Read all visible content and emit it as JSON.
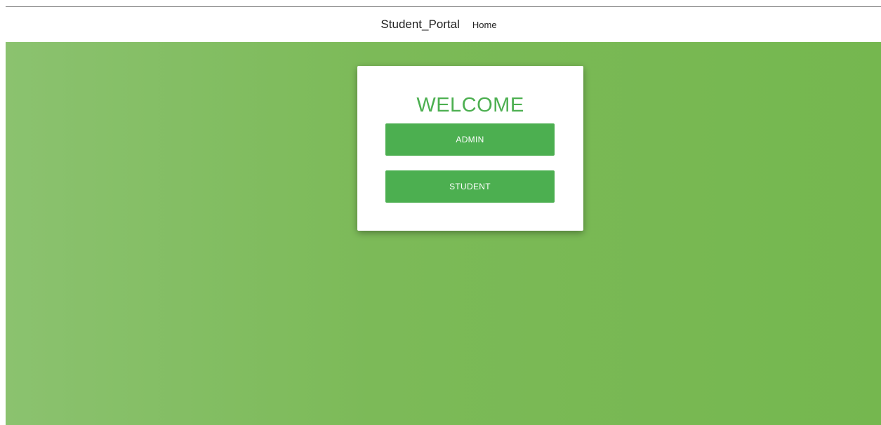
{
  "navbar": {
    "brand": "Student_Portal",
    "links": [
      {
        "label": "Home"
      }
    ]
  },
  "welcome_card": {
    "title": "WELCOME",
    "admin_button": "ADMIN",
    "student_button": "STUDENT"
  },
  "colors": {
    "accent": "#4caf50",
    "background_gradient": [
      "#8bc26f",
      "#75b74f"
    ],
    "card_background": "#ffffff"
  }
}
